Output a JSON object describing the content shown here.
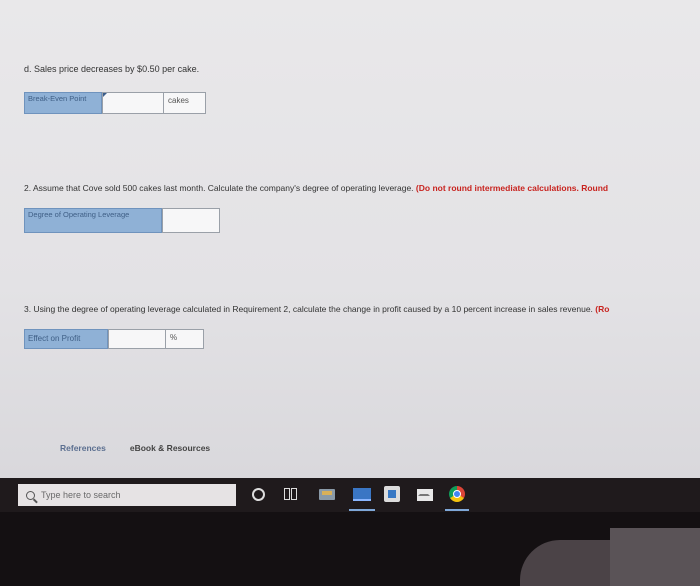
{
  "question_d": "d. Sales price decreases by $0.50 per cake.",
  "break_even": {
    "label": "Break-Even Point",
    "value": "",
    "unit": "cakes"
  },
  "question_2": {
    "text": "2. Assume that Cove sold 500 cakes last month. Calculate the company's degree of operating leverage.",
    "note": "(Do not round intermediate calculations. Round"
  },
  "dol": {
    "label": "Degree of Operating Leverage",
    "value": ""
  },
  "question_3": {
    "text": "3. Using the degree of operating leverage calculated in Requirement 2, calculate the change in profit caused by a 10 percent increase in sales revenue.",
    "note": "(Ro"
  },
  "effect": {
    "label": "Effect on Profit",
    "value": "",
    "unit": "%"
  },
  "links": {
    "references": "References",
    "ebook": "eBook & Resources"
  },
  "taskbar": {
    "search_placeholder": "Type here to search",
    "icons": [
      "search-icon",
      "cortana-icon",
      "task-view-icon",
      "file-explorer-icon",
      "edge-icon",
      "store-icon",
      "mail-icon",
      "chrome-icon"
    ]
  },
  "colors": {
    "label_bg": "#8fb1d6",
    "note_red": "#c8231f",
    "taskbar": "#1f1a1c"
  }
}
